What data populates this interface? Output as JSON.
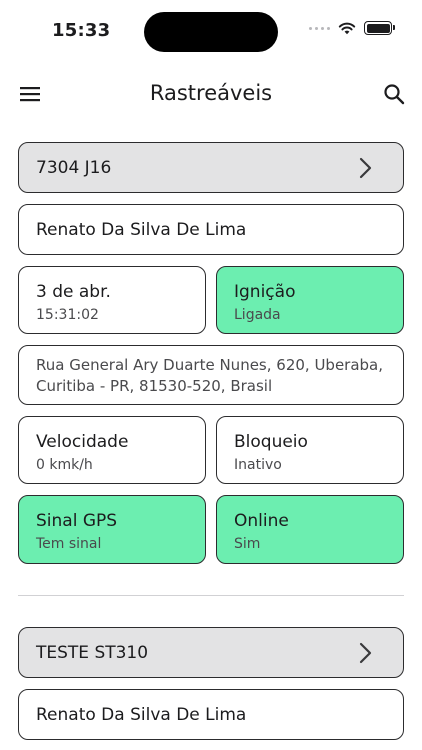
{
  "status_bar": {
    "time": "15:33"
  },
  "app_bar": {
    "title": "Rastreáveis"
  },
  "trackables": [
    {
      "name": "7304 J16",
      "owner": "Renato Da Silva De Lima",
      "date": "3 de abr.",
      "time": "15:31:02",
      "ignition": {
        "label": "Ignição",
        "value": "Ligada"
      },
      "address": "Rua General Ary Duarte Nunes, 620, Uberaba, Curitiba - PR, 81530-520, Brasil",
      "speed": {
        "label": "Velocidade",
        "value": "0 kmk/h"
      },
      "block": {
        "label": "Bloqueio",
        "value": "Inativo"
      },
      "gps": {
        "label": "Sinal GPS",
        "value": "Tem sinal"
      },
      "online": {
        "label": "Online",
        "value": "Sim"
      }
    },
    {
      "name": "TESTE ST310",
      "owner": "Renato Da Silva De Lima"
    }
  ],
  "colors": {
    "active_green": "#6ceeb0",
    "header_gray": "#e3e3e4"
  },
  "icons": {
    "menu": "menu-icon",
    "search": "search-icon",
    "chevron": "chevron-right-icon"
  }
}
